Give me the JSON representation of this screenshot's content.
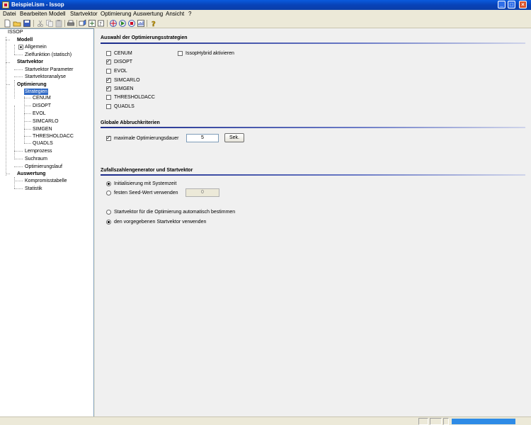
{
  "window": {
    "title": "Beispiel.ism - Issop"
  },
  "menu": [
    "Datei",
    "Bearbeiten",
    "Modell",
    "Startvektor",
    "Optimierung",
    "Auswertung",
    "Ansicht",
    "?"
  ],
  "tree": {
    "root": "ISSOP",
    "modell": "Modell",
    "allgemein": "Allgemein",
    "zielfunktion": "Zielfunktion (statisch)",
    "startvektor": "Startvektor",
    "startvektor_parameter": "Startvektor Parameter",
    "startvektoranalyse": "Startvektoranalyse",
    "optimierung": "Optimierung",
    "strategien": "Strategien",
    "strategies": [
      "CENUM",
      "DISOPT",
      "EVOL",
      "SIMCARLO",
      "SIMGEN",
      "THRESHOLDACC",
      "QUADLS"
    ],
    "lernprozess": "Lernprozess",
    "suchraum": "Suchraum",
    "optimierungslauf": "Optimierungslauf",
    "auswertung": "Auswertung",
    "kompromisstabelle": "Kompromisstabelle",
    "statistik": "Statistik"
  },
  "strategien": {
    "title": "Auswahl der Optimierungsstrategien",
    "items": [
      {
        "label": "CENUM",
        "checked": false
      },
      {
        "label": "DISOPT",
        "checked": true
      },
      {
        "label": "EVOL",
        "checked": false
      },
      {
        "label": "SIMCARLO",
        "checked": true
      },
      {
        "label": "SIMGEN",
        "checked": true
      },
      {
        "label": "THRESHOLDACC",
        "checked": false
      },
      {
        "label": "QUADLS",
        "checked": false
      }
    ],
    "hybrid": {
      "label": "IssopHybrid aktivieren",
      "checked": false
    }
  },
  "abbruch": {
    "title": "Globale Abbruchkriterien",
    "max_dauer_label": "maximale Optimierungsdauer",
    "max_dauer_checked": true,
    "max_dauer_value": "5",
    "unit_button": "Sek."
  },
  "zufall": {
    "title": "Zufallszahlengenerator und Startvektor",
    "init_system": "Initialisierung mit Systemzeit",
    "fixed_seed": "festen Seed-Wert verwenden",
    "seed_value": "0",
    "auto_start": "Startvektor für die Optimierung automatisch bestimmen",
    "given_start": "den vorgegebenen Startvektor verwenden"
  },
  "colors": {
    "titlebar": "#0a4fd0",
    "selection": "#316ac5",
    "progress": "#2e8be6"
  }
}
